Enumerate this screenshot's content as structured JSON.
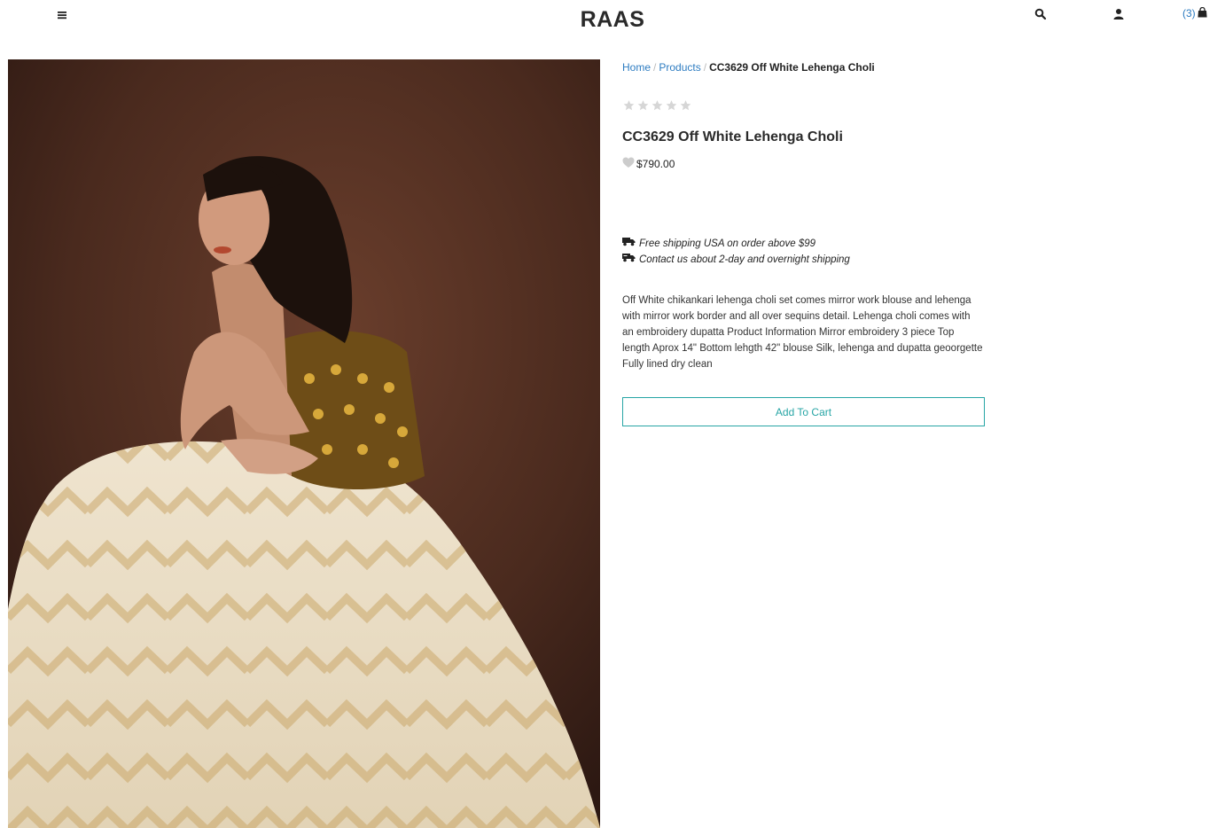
{
  "header": {
    "logo": "RAAS",
    "menu_icon": "hamburger-menu-icon",
    "search_icon": "search-icon",
    "user_icon": "user-icon",
    "cart_count": "(3)",
    "cart_icon": "shopping-bag-icon"
  },
  "breadcrumb": {
    "home": "Home",
    "separator": "/",
    "products": "Products",
    "current": "CC3629 Off White Lehenga Choli"
  },
  "product": {
    "rating": 0,
    "rating_max": 5,
    "title": "CC3629 Off White Lehenga Choli",
    "price": "$790.00",
    "shipping": [
      "Free shipping USA on order above $99",
      "Contact us about 2-day and overnight shipping"
    ],
    "description": "Off White chikankari lehenga choli set comes mirror work blouse and lehenga with mirror work border and all over sequins detail. Lehenga choli comes with an embroidery dupatta Product Information Mirror embroidery 3 piece Top length Aprox 14\" Bottom lehgth 42\" blouse Silk, lehenga and dupatta geoorgette Fully lined dry clean",
    "add_to_cart_label": "Add To Cart"
  },
  "colors": {
    "link": "#2d7cc1",
    "accent": "#27a5a5",
    "star_empty": "#d6d6d6"
  }
}
